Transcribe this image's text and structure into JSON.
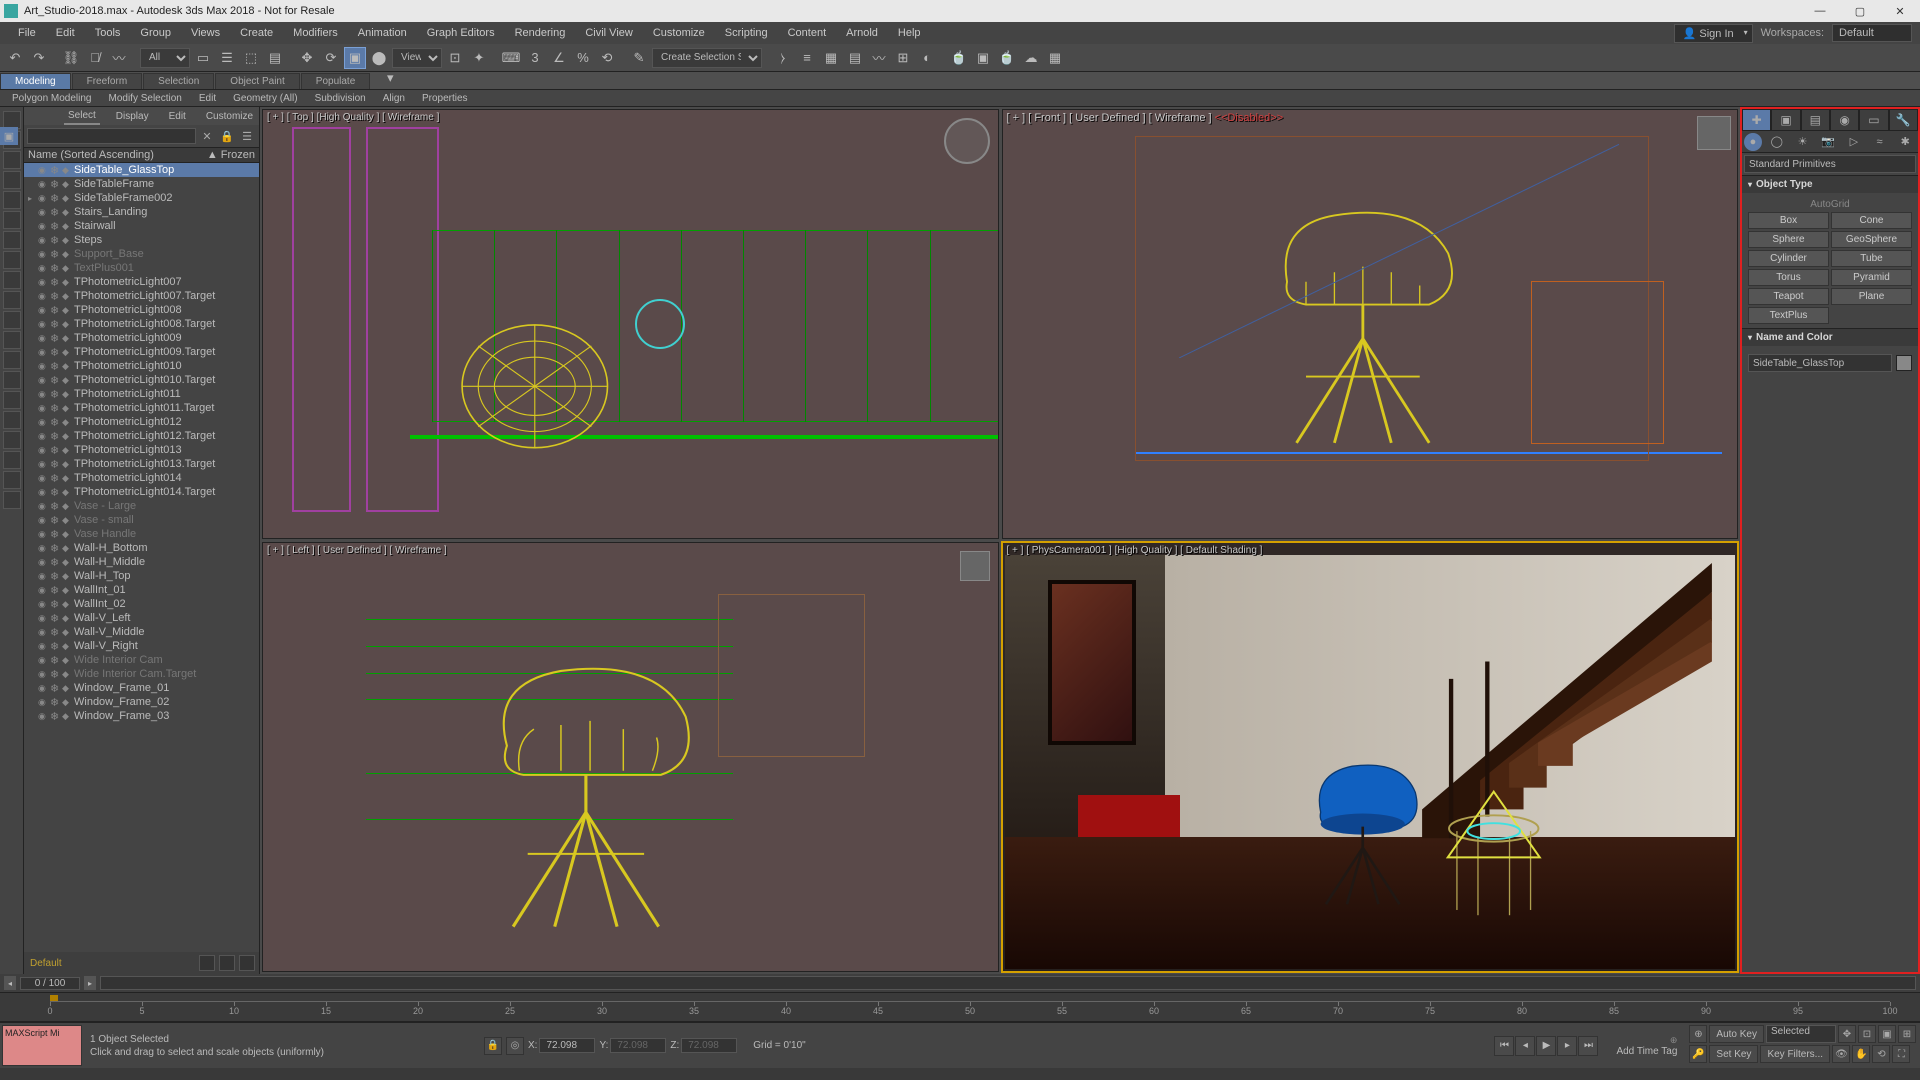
{
  "title": "Art_Studio-2018.max - Autodesk 3ds Max 2018 - Not for Resale",
  "menu": [
    "File",
    "Edit",
    "Tools",
    "Group",
    "Views",
    "Create",
    "Modifiers",
    "Animation",
    "Graph Editors",
    "Rendering",
    "Civil View",
    "Customize",
    "Scripting",
    "Content",
    "Arnold",
    "Help"
  ],
  "signin": "Sign In",
  "workspace_label": "Workspaces:",
  "workspace_value": "Default",
  "toolbar_filter": "All",
  "toolbar_view": "View",
  "toolbar_selset": "Create Selection Se",
  "ribbon_tabs": [
    "Modeling",
    "Freeform",
    "Selection",
    "Object Paint",
    "Populate"
  ],
  "ribbon_sub": [
    "Polygon Modeling",
    "Modify Selection",
    "Edit",
    "Geometry (All)",
    "Subdivision",
    "Align",
    "Properties"
  ],
  "scene_tabs": [
    "Select",
    "Display",
    "Edit",
    "Customize"
  ],
  "scene_header_name": "Name (Sorted Ascending)",
  "scene_header_frozen": "▲ Frozen",
  "scene_items": [
    {
      "name": "SideTable_GlassTop",
      "sel": true
    },
    {
      "name": "SideTableFrame"
    },
    {
      "name": "SideTableFrame002",
      "exp": true
    },
    {
      "name": "Stairs_Landing"
    },
    {
      "name": "Stairwall"
    },
    {
      "name": "Steps"
    },
    {
      "name": "Support_Base",
      "dim": true
    },
    {
      "name": "TextPlus001",
      "dim": true
    },
    {
      "name": "TPhotometricLight007"
    },
    {
      "name": "TPhotometricLight007.Target"
    },
    {
      "name": "TPhotometricLight008"
    },
    {
      "name": "TPhotometricLight008.Target"
    },
    {
      "name": "TPhotometricLight009"
    },
    {
      "name": "TPhotometricLight009.Target"
    },
    {
      "name": "TPhotometricLight010"
    },
    {
      "name": "TPhotometricLight010.Target"
    },
    {
      "name": "TPhotometricLight011"
    },
    {
      "name": "TPhotometricLight011.Target"
    },
    {
      "name": "TPhotometricLight012"
    },
    {
      "name": "TPhotometricLight012.Target"
    },
    {
      "name": "TPhotometricLight013"
    },
    {
      "name": "TPhotometricLight013.Target"
    },
    {
      "name": "TPhotometricLight014"
    },
    {
      "name": "TPhotometricLight014.Target"
    },
    {
      "name": "Vase - Large",
      "dim": true
    },
    {
      "name": "Vase - small",
      "dim": true
    },
    {
      "name": "Vase Handle",
      "dim": true
    },
    {
      "name": "Wall-H_Bottom"
    },
    {
      "name": "Wall-H_Middle"
    },
    {
      "name": "Wall-H_Top"
    },
    {
      "name": "WallInt_01"
    },
    {
      "name": "WallInt_02"
    },
    {
      "name": "Wall-V_Left"
    },
    {
      "name": "Wall-V_Middle"
    },
    {
      "name": "Wall-V_Right"
    },
    {
      "name": "Wide Interior Cam",
      "dim": true
    },
    {
      "name": "Wide Interior Cam.Target",
      "dim": true
    },
    {
      "name": "Window_Frame_01"
    },
    {
      "name": "Window_Frame_02"
    },
    {
      "name": "Window_Frame_03"
    }
  ],
  "layer_default": "Default",
  "vp_labels": {
    "top": "[ + ] [ Top ] [High Quality ] [ Wireframe ]",
    "front_a": "[ + ] [ Front ] [ User Defined ] [ Wireframe ]   ",
    "front_b": "<<Disabled>>",
    "left": "[ + ] [ Left ] [ User Defined ] [ Wireframe ]",
    "persp": "[ + ] [ PhysCamera001 ] [High Quality ] [ Default Shading ]"
  },
  "cmd": {
    "dropdown": "Standard Primitives",
    "roll_objtype": "Object Type",
    "autogrid": "AutoGrid",
    "prims": [
      "Box",
      "Cone",
      "Sphere",
      "GeoSphere",
      "Cylinder",
      "Tube",
      "Torus",
      "Pyramid",
      "Teapot",
      "Plane",
      "TextPlus"
    ],
    "roll_namecolor": "Name and Color",
    "obj_name": "SideTable_GlassTop"
  },
  "timeslider": "0 / 100",
  "time_ticks": [
    0,
    5,
    10,
    15,
    20,
    25,
    30,
    35,
    40,
    45,
    50,
    55,
    60,
    65,
    70,
    75,
    80,
    85,
    90,
    95,
    100
  ],
  "status": {
    "sel": "1 Object Selected",
    "hint": "Click and drag to select and scale objects (uniformly)",
    "maxscript": "MAXScript Mi",
    "x": "72.098",
    "y": "72.098",
    "z": "72.098",
    "grid": "Grid = 0'10\"",
    "addtag": "Add Time Tag",
    "autokey": "Auto Key",
    "setkey": "Set Key",
    "selected": "Selected",
    "keyfilters": "Key Filters..."
  }
}
